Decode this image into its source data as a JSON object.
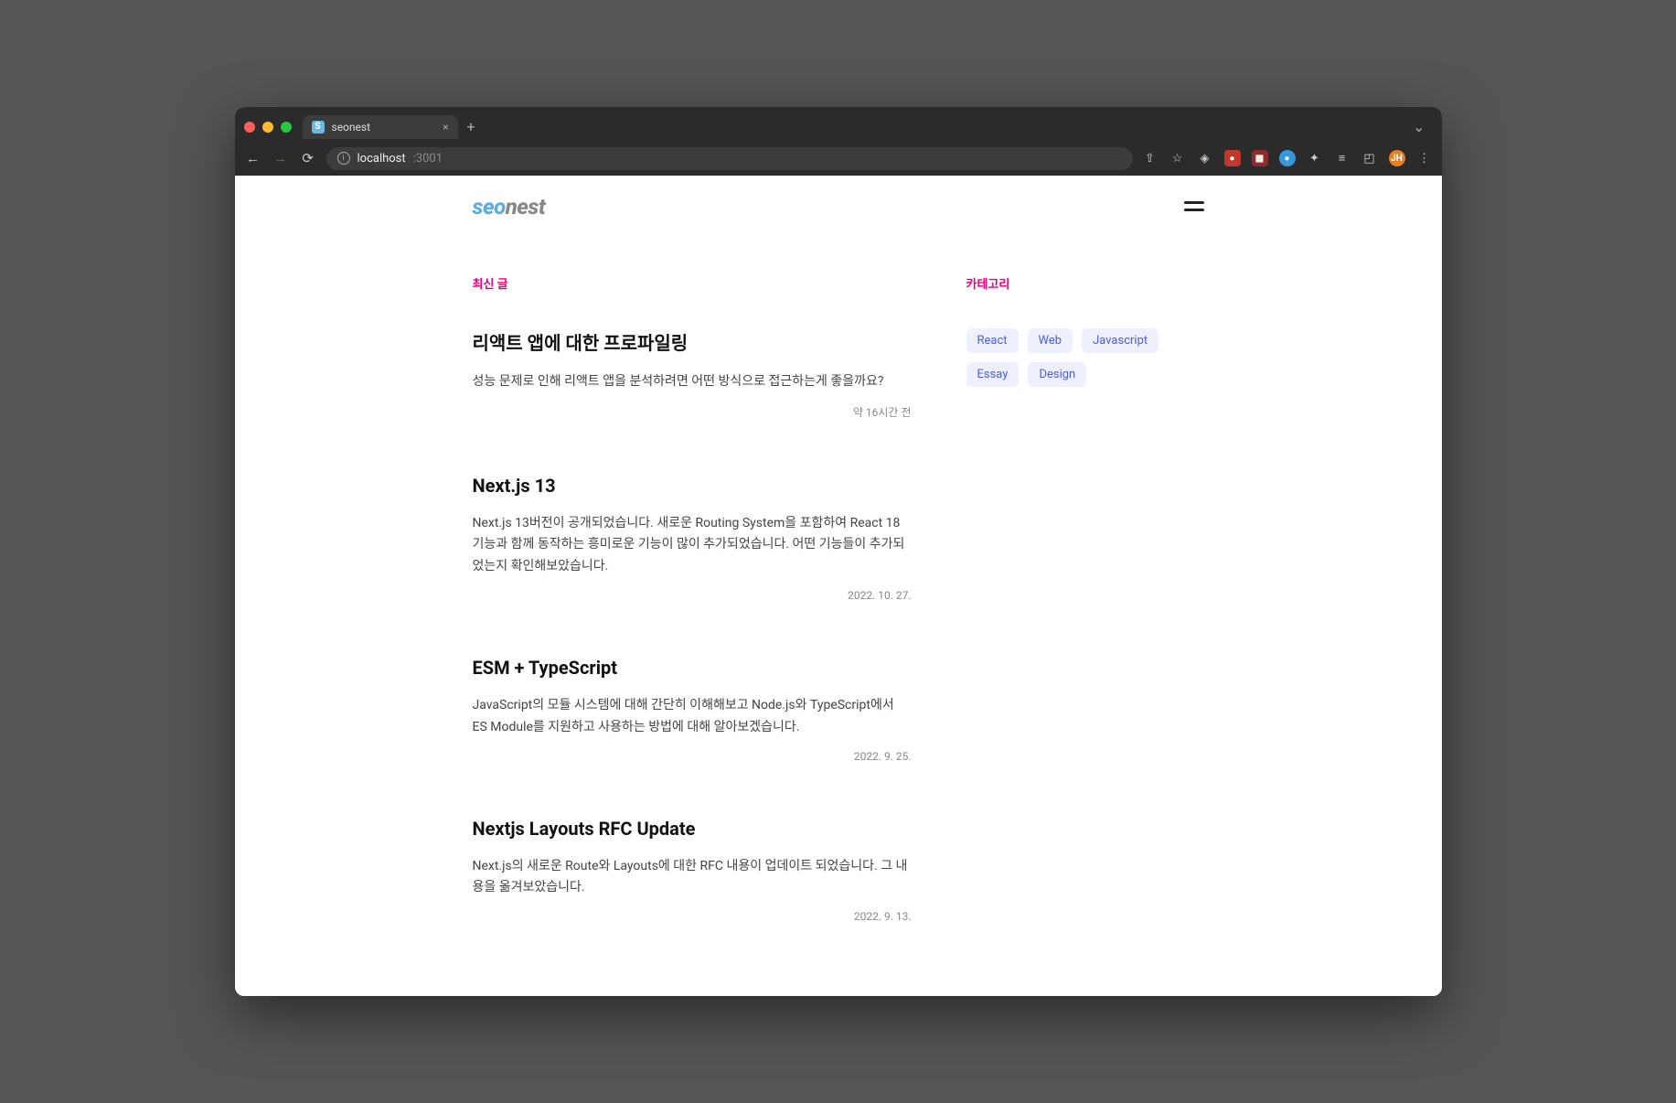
{
  "browser": {
    "tab_title": "seonest",
    "url_host": "localhost",
    "url_port": ":3001",
    "avatar_initials": "JH"
  },
  "header": {
    "logo_seo": "seo",
    "logo_nest": "nest"
  },
  "posts_section_label": "최신 글",
  "categories_section_label": "카테고리",
  "posts": [
    {
      "title": "리액트 앱에 대한 프로파일링",
      "excerpt": "성능 문제로 인해 리액트 앱을 분석하려면 어떤 방식으로 접근하는게 좋을까요?",
      "date": "약 16시간 전"
    },
    {
      "title": "Next.js 13",
      "excerpt": "Next.js 13버전이 공개되었습니다. 새로운 Routing System을 포함하여 React 18 기능과 함께 동작하는 흥미로운 기능이 많이 추가되었습니다. 어떤 기능들이 추가되었는지 확인해보았습니다.",
      "date": "2022. 10. 27."
    },
    {
      "title": "ESM + TypeScript",
      "excerpt": "JavaScript의 모듈 시스템에 대해 간단히 이해해보고 Node.js와 TypeScript에서 ES Module를 지원하고 사용하는 방법에 대해 알아보겠습니다.",
      "date": "2022. 9. 25."
    },
    {
      "title": "Nextjs Layouts RFC Update",
      "excerpt": "Next.js의 새로운 Route와 Layouts에 대한 RFC 내용이 업데이트 되었습니다. 그 내용을 옮겨보았습니다.",
      "date": "2022. 9. 13."
    }
  ],
  "categories": [
    "React",
    "Web",
    "Javascript",
    "Essay",
    "Design"
  ]
}
